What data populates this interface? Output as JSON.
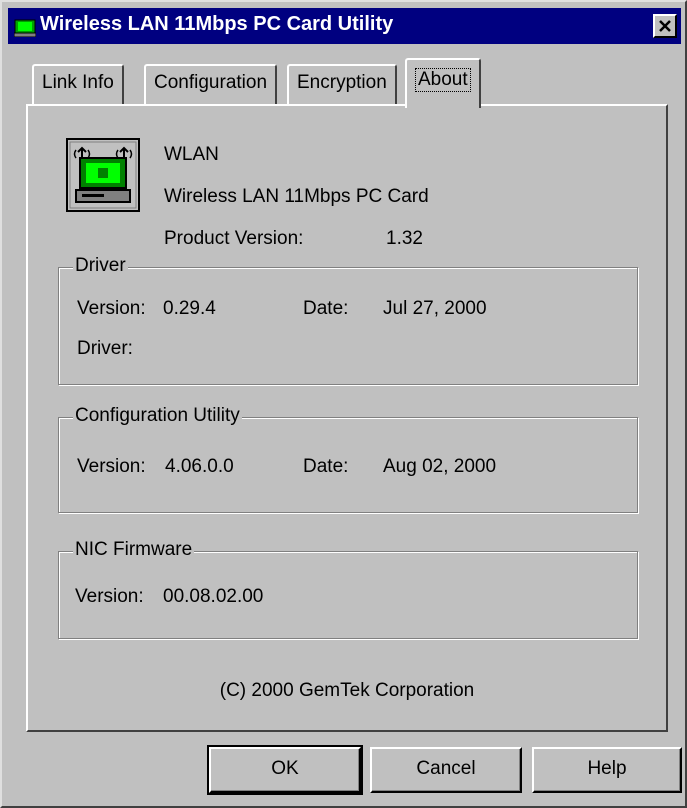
{
  "window": {
    "title": "Wireless LAN 11Mbps PC Card Utility",
    "close_label": "×"
  },
  "tabs": [
    {
      "label": "Link Info",
      "active": false
    },
    {
      "label": "Configuration",
      "active": false
    },
    {
      "label": "Encryption",
      "active": false
    },
    {
      "label": "About",
      "active": true
    }
  ],
  "about": {
    "product_name": "WLAN",
    "product_desc": "Wireless LAN 11Mbps PC Card",
    "product_version_label": "Product Version:",
    "product_version": "1.32",
    "product_icon": "wireless-card-icon",
    "copyright": "(C) 2000 GemTek Corporation"
  },
  "driver": {
    "title": "Driver",
    "version_label": "Version:",
    "version": "0.29.4",
    "date_label": "Date:",
    "date": "Jul 27, 2000",
    "driver_label": "Driver:",
    "driver_value": ""
  },
  "config_utility": {
    "title": "Configuration Utility",
    "version_label": "Version:",
    "version": "4.06.0.0",
    "date_label": "Date:",
    "date": "Aug 02, 2000"
  },
  "nic_firmware": {
    "title": "NIC Firmware",
    "version_label": "Version:",
    "version": "00.08.02.00"
  },
  "buttons": {
    "ok": "OK",
    "cancel": "Cancel",
    "help": "Help"
  },
  "colors": {
    "titlebar": "#000080",
    "face": "#c0c0c0",
    "icon_green": "#00c000"
  }
}
